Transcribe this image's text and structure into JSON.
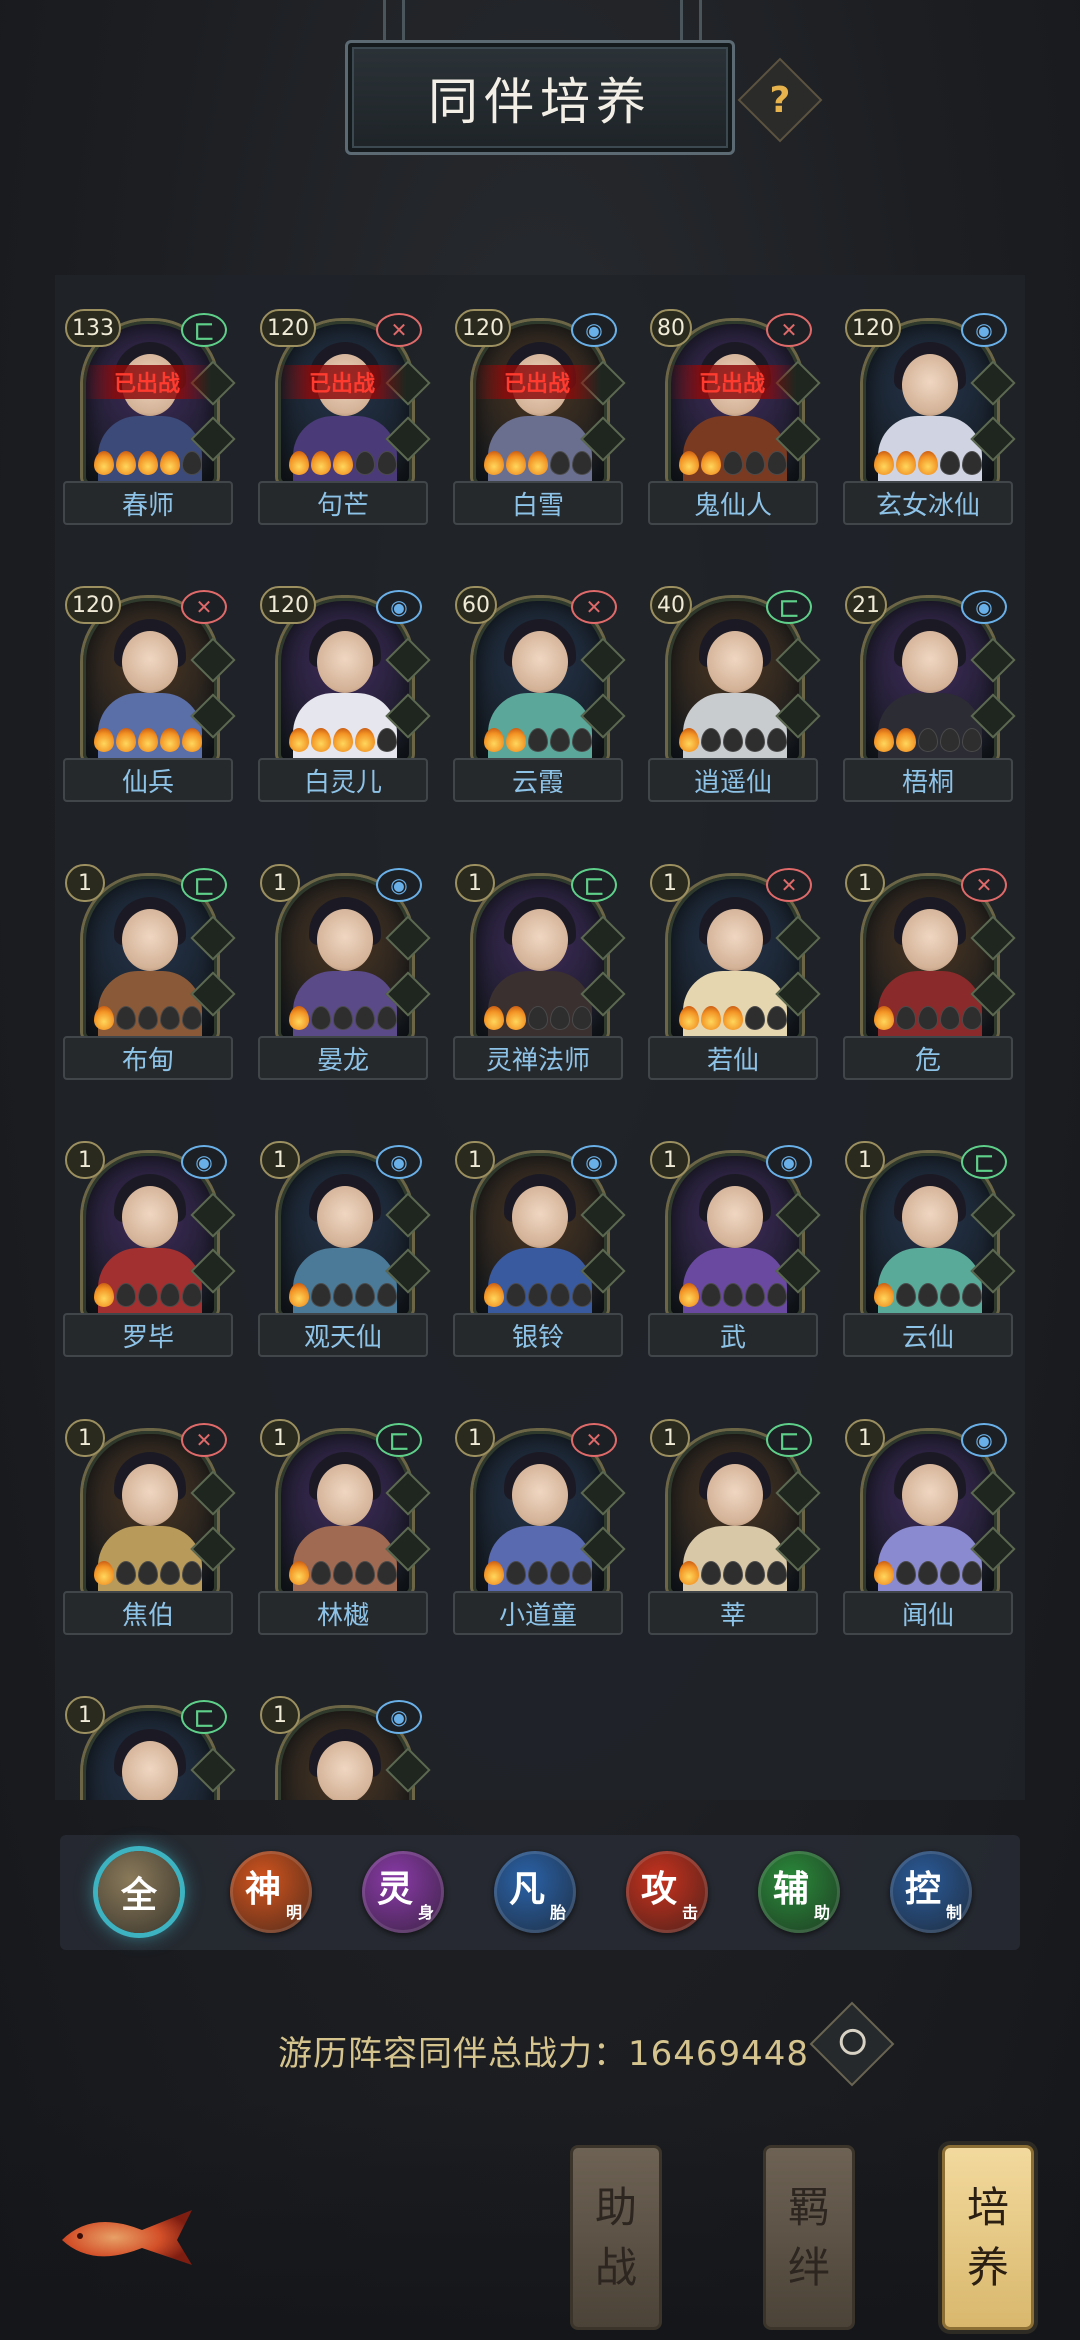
{
  "header": {
    "title": "同伴培养",
    "help": "?"
  },
  "companions": [
    {
      "name": "春师",
      "level": "133",
      "type": "control",
      "flames": [
        1,
        1,
        1,
        1,
        0
      ],
      "deployed": "已出战",
      "robe": "#3b4a78"
    },
    {
      "name": "句芒",
      "level": "120",
      "type": "attack",
      "flames": [
        1,
        1,
        1,
        0,
        0
      ],
      "deployed": "已出战",
      "robe": "#4a3a78"
    },
    {
      "name": "白雪",
      "level": "120",
      "type": "support",
      "flames": [
        1,
        1,
        1,
        0,
        0
      ],
      "deployed": "已出战",
      "robe": "#6a6f90"
    },
    {
      "name": "鬼仙人",
      "level": "80",
      "type": "attack",
      "flames": [
        1,
        1,
        0,
        0,
        0
      ],
      "deployed": "已出战",
      "robe": "#7a3a22"
    },
    {
      "name": "玄女冰仙",
      "level": "120",
      "type": "support",
      "flames": [
        1,
        1,
        1,
        0,
        0
      ],
      "deployed": "",
      "robe": "#d0d4e2"
    },
    {
      "name": "仙兵",
      "level": "120",
      "type": "attack",
      "flames": [
        1,
        1,
        1,
        1,
        1
      ],
      "deployed": "",
      "robe": "#5a6ea8"
    },
    {
      "name": "白灵儿",
      "level": "120",
      "type": "support",
      "flames": [
        1,
        1,
        1,
        1,
        0
      ],
      "deployed": "",
      "robe": "#e6e6ee"
    },
    {
      "name": "云霞",
      "level": "60",
      "type": "attack",
      "flames": [
        1,
        1,
        0,
        0,
        0
      ],
      "deployed": "",
      "robe": "#5ba79a"
    },
    {
      "name": "逍遥仙",
      "level": "40",
      "type": "control",
      "flames": [
        1,
        0,
        0,
        0,
        0
      ],
      "deployed": "",
      "robe": "#c9cccf"
    },
    {
      "name": "梧桐",
      "level": "21",
      "type": "support",
      "flames": [
        1,
        1,
        0,
        0,
        0
      ],
      "deployed": "",
      "robe": "#2c2c34"
    },
    {
      "name": "布甸",
      "level": "1",
      "type": "control",
      "flames": [
        1,
        0,
        0,
        0,
        0
      ],
      "deployed": "",
      "robe": "#8a5a38"
    },
    {
      "name": "晏龙",
      "level": "1",
      "type": "support",
      "flames": [
        1,
        0,
        0,
        0,
        0
      ],
      "deployed": "",
      "robe": "#5a4a88"
    },
    {
      "name": "灵禅法师",
      "level": "1",
      "type": "control",
      "flames": [
        1,
        1,
        0,
        0,
        0
      ],
      "deployed": "",
      "robe": "#3a3030"
    },
    {
      "name": "若仙",
      "level": "1",
      "type": "attack",
      "flames": [
        1,
        1,
        1,
        0,
        0
      ],
      "deployed": "",
      "robe": "#e6d6b0"
    },
    {
      "name": "危",
      "level": "1",
      "type": "attack",
      "flames": [
        1,
        0,
        0,
        0,
        0
      ],
      "deployed": "",
      "robe": "#8b2a2a"
    },
    {
      "name": "罗毕",
      "level": "1",
      "type": "support",
      "flames": [
        1,
        0,
        0,
        0,
        0
      ],
      "deployed": "",
      "robe": "#a23030"
    },
    {
      "name": "观天仙",
      "level": "1",
      "type": "support",
      "flames": [
        1,
        0,
        0,
        0,
        0
      ],
      "deployed": "",
      "robe": "#4a7a98"
    },
    {
      "name": "银铃",
      "level": "1",
      "type": "support",
      "flames": [
        1,
        0,
        0,
        0,
        0
      ],
      "deployed": "",
      "robe": "#3a5aa0"
    },
    {
      "name": "武",
      "level": "1",
      "type": "support",
      "flames": [
        1,
        0,
        0,
        0,
        0
      ],
      "deployed": "",
      "robe": "#6a4aa0"
    },
    {
      "name": "云仙",
      "level": "1",
      "type": "control",
      "flames": [
        1,
        0,
        0,
        0,
        0
      ],
      "deployed": "",
      "robe": "#5aaa9a"
    },
    {
      "name": "焦伯",
      "level": "1",
      "type": "attack",
      "flames": [
        1,
        0,
        0,
        0,
        0
      ],
      "deployed": "",
      "robe": "#b89a5a"
    },
    {
      "name": "林樾",
      "level": "1",
      "type": "control",
      "flames": [
        1,
        0,
        0,
        0,
        0
      ],
      "deployed": "",
      "robe": "#a06a52"
    },
    {
      "name": "小道童",
      "level": "1",
      "type": "attack",
      "flames": [
        1,
        0,
        0,
        0,
        0
      ],
      "deployed": "",
      "robe": "#5a6ab0"
    },
    {
      "name": "莘",
      "level": "1",
      "type": "control",
      "flames": [
        1,
        0,
        0,
        0,
        0
      ],
      "deployed": "",
      "robe": "#d8c8a8"
    },
    {
      "name": "闻仙",
      "level": "1",
      "type": "support",
      "flames": [
        1,
        0,
        0,
        0,
        0
      ],
      "deployed": "",
      "robe": "#8a8ad0"
    },
    {
      "name": "",
      "level": "1",
      "type": "control",
      "flames": [],
      "deployed": "",
      "robe": "#3a4a80"
    },
    {
      "name": "",
      "level": "1",
      "type": "support",
      "flames": [],
      "deployed": "",
      "robe": "#2a2a30"
    }
  ],
  "type_icons": {
    "control": "匚",
    "attack": "✕",
    "support": "◉"
  },
  "type_colors": {
    "control": "#5fd08a",
    "attack": "#e06a6a",
    "support": "#6ab0e8"
  },
  "filters": [
    {
      "main": "全",
      "sub": "",
      "color": "#8a7a5a",
      "active": true
    },
    {
      "main": "神",
      "sub": "明",
      "color": "#d2541e",
      "active": false
    },
    {
      "main": "灵",
      "sub": "身",
      "color": "#8a3aa8",
      "active": false
    },
    {
      "main": "凡",
      "sub": "胎",
      "color": "#2a62a8",
      "active": false
    },
    {
      "main": "攻",
      "sub": "击",
      "color": "#c8321e",
      "active": false
    },
    {
      "main": "辅",
      "sub": "助",
      "color": "#2a8a3a",
      "active": false
    },
    {
      "main": "控",
      "sub": "制",
      "color": "#2a5a98",
      "active": false
    }
  ],
  "power": {
    "label": "游历阵容同伴总战力：",
    "value": "16469448"
  },
  "tabs": [
    {
      "label_1": "助",
      "label_2": "战",
      "active": false
    },
    {
      "label_1": "羁",
      "label_2": "绊",
      "active": false
    },
    {
      "label_1": "培",
      "label_2": "养",
      "active": true
    }
  ]
}
